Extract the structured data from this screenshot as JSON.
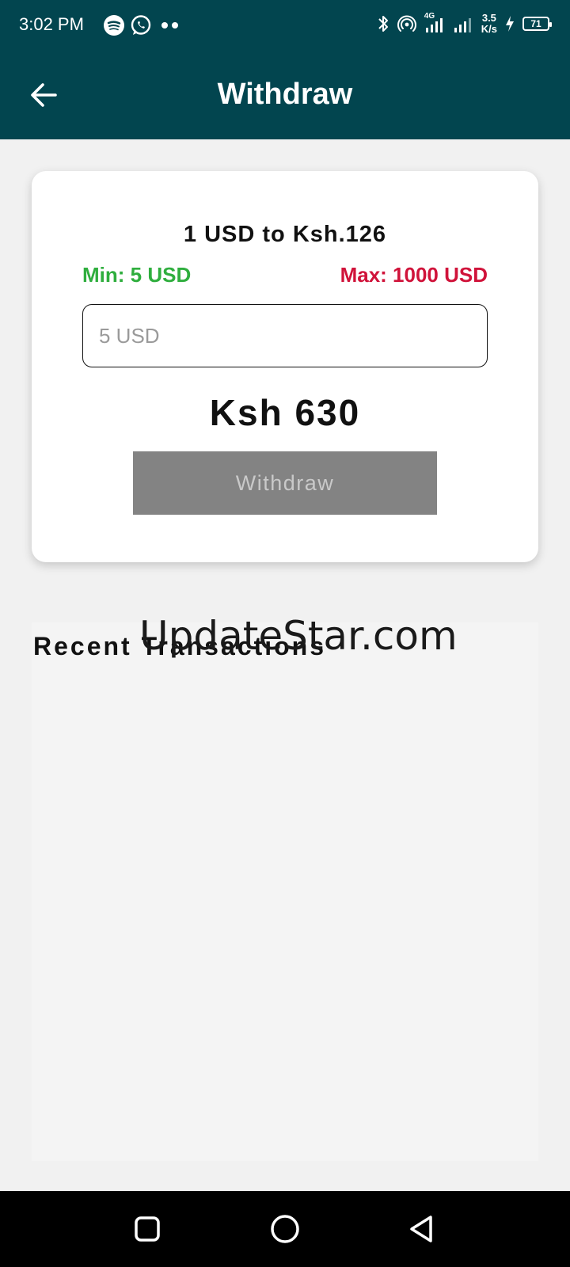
{
  "status_bar": {
    "time": "3:02 PM",
    "net_speed_value": "3.5",
    "net_speed_unit": "K/s",
    "battery": "71",
    "network_type": "4G"
  },
  "app_bar": {
    "title": "Withdraw"
  },
  "card": {
    "rate": "1 USD to Ksh.126",
    "min": "Min: 5 USD",
    "max": "Max: 1000 USD",
    "amount_placeholder": "5 USD",
    "converted_amount": "Ksh 630",
    "withdraw_label": "Withdraw"
  },
  "recent": {
    "title": "Recent Transactions"
  },
  "watermark": "UpdateStar.com",
  "colors": {
    "primary": "#02454f",
    "min": "#2fae3e",
    "max": "#d0133a",
    "button_disabled": "#838383"
  }
}
